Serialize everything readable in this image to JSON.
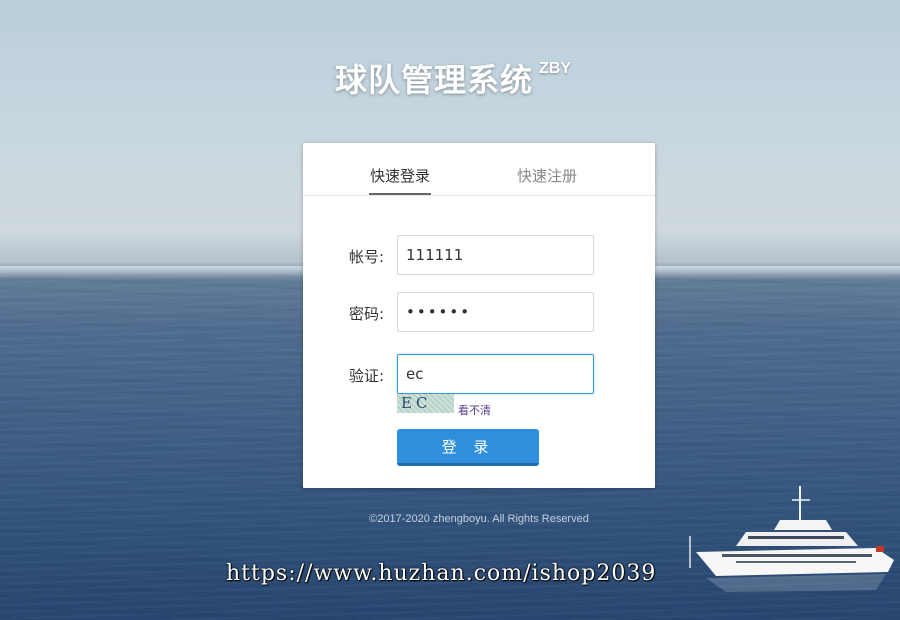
{
  "app": {
    "title": "球队管理系统",
    "title_sup": "ZBY"
  },
  "tabs": [
    {
      "label": "快速登录",
      "active": true
    },
    {
      "label": "快速注册",
      "active": false
    }
  ],
  "form": {
    "account": {
      "label": "帐号:",
      "value": "111111"
    },
    "password": {
      "label": "密码:",
      "value": "••••••"
    },
    "captcha": {
      "label": "验证:",
      "value": "ec",
      "image_text": "EC",
      "refresh_label": "看不清"
    },
    "submit_label": "登 录"
  },
  "footer": {
    "copyright": "©2017-2020 zhengboyu. All Rights Reserved"
  },
  "watermark": "https://www.huzhan.com/ishop2039",
  "colors": {
    "primary_button": "#2f8fdc",
    "focus_border": "#3a9ad9"
  }
}
